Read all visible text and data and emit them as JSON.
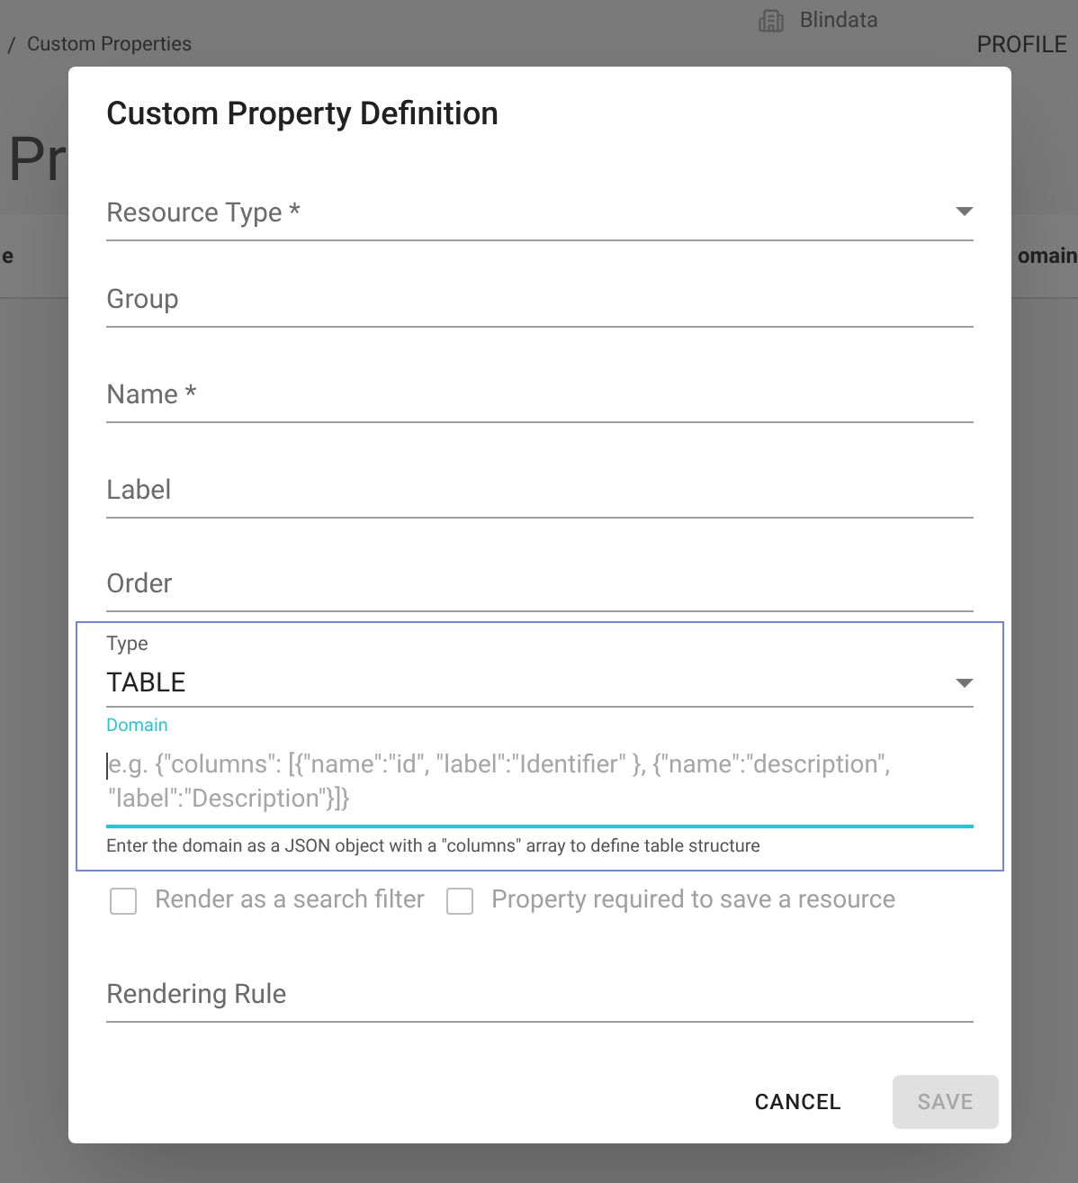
{
  "background": {
    "breadcrumb_separator": "/",
    "breadcrumb": "Custom Properties",
    "brand": "Blindata",
    "profile": "PROFILE",
    "page_title": "Pr",
    "table_columns": [
      "e",
      "omain"
    ]
  },
  "dialog": {
    "title": "Custom Property Definition",
    "fields": [
      {
        "kind": "select",
        "label": "Resource Type *"
      },
      {
        "kind": "text",
        "label": "Group"
      },
      {
        "kind": "text",
        "label": "Name *"
      },
      {
        "kind": "text",
        "label": "Label"
      },
      {
        "kind": "text",
        "label": "Order"
      }
    ],
    "highlighted": {
      "type": {
        "label": "Type",
        "value": "TABLE"
      },
      "domain": {
        "label": "Domain",
        "focused": true,
        "placeholder": "e.g. {\"columns\": [{\"name\":\"id\", \"label\":\"Identifier\" }, {\"name\":\"description\", \"label\":\"Description\"}]}",
        "helper": "Enter the domain as a JSON object with a \"columns\" array to define table structure"
      }
    },
    "checkboxes": [
      {
        "label": "Render as a search filter",
        "checked": false
      },
      {
        "label": "Property required to save a resource",
        "checked": false
      }
    ],
    "rendering_rule": {
      "label": "Rendering Rule"
    },
    "buttons": [
      {
        "label": "CANCEL",
        "disabled": false
      },
      {
        "label": "SAVE",
        "disabled": true
      }
    ]
  }
}
